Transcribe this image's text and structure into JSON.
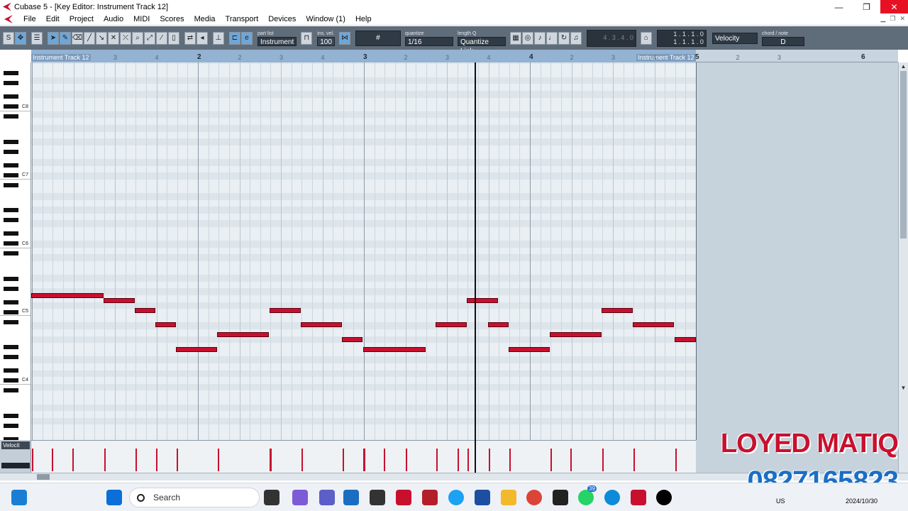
{
  "window": {
    "title": "Cubase 5 - [Key Editor: Instrument Track 12]",
    "buttons": {
      "minimize": "—",
      "restore": "❐",
      "close": "✕"
    }
  },
  "menu": [
    "File",
    "Edit",
    "Project",
    "Audio",
    "MIDI",
    "Scores",
    "Media",
    "Transport",
    "Devices",
    "Window (1)",
    "Help"
  ],
  "toolbar": {
    "part_list_label": "part list",
    "part_list_value": "Instrument",
    "ins_vel_label": "ins. vel.",
    "ins_vel_value": "100",
    "quantize_label": "quantize",
    "quantize_value": "1/16",
    "length_q_label": "length Q",
    "length_q_value": "Quantize Link",
    "dim_position": "4 . 3 . 4 .   0",
    "position_1": "1 . 1 . 1 .   0",
    "position_2": "1 . 1 . 1 .   0",
    "controller_value": "Velocity",
    "chord_label": "chord / note",
    "chord_value": "D"
  },
  "ruler": {
    "part_start_label": "Instrument Track 12",
    "part_end_label": "Instrument Track 12",
    "bars": [
      "2",
      "3",
      "4",
      "5",
      "6"
    ],
    "beats": [
      "3",
      "4",
      "2",
      "3",
      "4",
      "2",
      "3",
      "4",
      "2",
      "3",
      "4",
      "2",
      "3",
      "4"
    ]
  },
  "keyboard": {
    "octave_labels": [
      "C8",
      "C7",
      "C6",
      "C5",
      "C4"
    ]
  },
  "velocity_lane": {
    "selector": "Velocit"
  },
  "watermark": {
    "line1": "LOYED MATIQ",
    "line2": "0827165823"
  },
  "taskbar": {
    "search_placeholder": "Search",
    "badge_count": "39",
    "lang": "US",
    "date": "2024/10/30"
  }
}
